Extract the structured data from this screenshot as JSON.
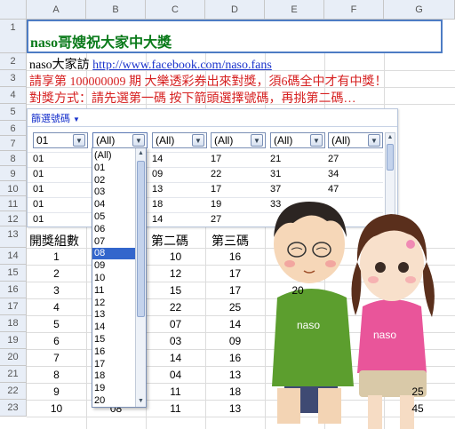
{
  "columns": [
    "A",
    "B",
    "C",
    "D",
    "E",
    "F",
    "G"
  ],
  "rows": [
    "1",
    "2",
    "3",
    "4",
    "5",
    "6",
    "7",
    "8",
    "9",
    "10",
    "11",
    "12",
    "13",
    "14",
    "15",
    "16",
    "17",
    "18",
    "19",
    "20",
    "21",
    "22",
    "23"
  ],
  "title": "naso哥嫂祝大家中大獎",
  "line2_prefix": "naso大家訪",
  "line2_link": "http://www.facebook.com/naso.fans",
  "line3": "請享第 100000009 期 大樂透彩券出來對獎，須6碼全中才有中獎！",
  "line4": "對獎方式：請先選第一碼 按下箭頭選擇號碼，再挑第二碼…",
  "filter": {
    "title": "篩選號碼",
    "selects": [
      "01",
      "(All)",
      "(All)",
      "(All)",
      "(All)",
      "(All)"
    ],
    "rows": [
      [
        "01",
        "",
        "14",
        "17",
        "21",
        "27"
      ],
      [
        "01",
        "",
        "09",
        "22",
        "31",
        "34"
      ],
      [
        "01",
        "",
        "13",
        "17",
        "37",
        "47"
      ],
      [
        "01",
        "",
        "18",
        "19",
        "33",
        ""
      ],
      [
        "01",
        "",
        "14",
        "27",
        "",
        ""
      ]
    ]
  },
  "dropdown": {
    "items": [
      "(All)",
      "01",
      "02",
      "03",
      "04",
      "05",
      "06",
      "07",
      "08",
      "09",
      "10",
      "11",
      "12",
      "13",
      "14",
      "15",
      "16",
      "17",
      "18",
      "19",
      "20"
    ],
    "selected": "08"
  },
  "table": {
    "headers": [
      "開獎組數",
      "",
      "第二碼",
      "第三碼"
    ],
    "rows": [
      [
        "1",
        "",
        "10",
        "16"
      ],
      [
        "2",
        "",
        "12",
        "17"
      ],
      [
        "3",
        "",
        "15",
        "17"
      ],
      [
        "4",
        "",
        "22",
        "25"
      ],
      [
        "5",
        "",
        "07",
        "14"
      ],
      [
        "6",
        "",
        "03",
        "09"
      ],
      [
        "7",
        "",
        "14",
        "16"
      ],
      [
        "8",
        "",
        "04",
        "13"
      ],
      [
        "9",
        "",
        "11",
        "18"
      ],
      [
        "10",
        "08",
        "11",
        "13"
      ]
    ],
    "right_values": [
      "20",
      "25",
      "45"
    ]
  },
  "illustration": {
    "shirt_text_left": "naso",
    "shirt_text_right": "naso"
  },
  "colors": {
    "title_green": "#0a7a1a",
    "red": "#d62020",
    "link": "#1a33cc",
    "select_blue": "#3366cc",
    "header_bg": "#e8eef7"
  }
}
